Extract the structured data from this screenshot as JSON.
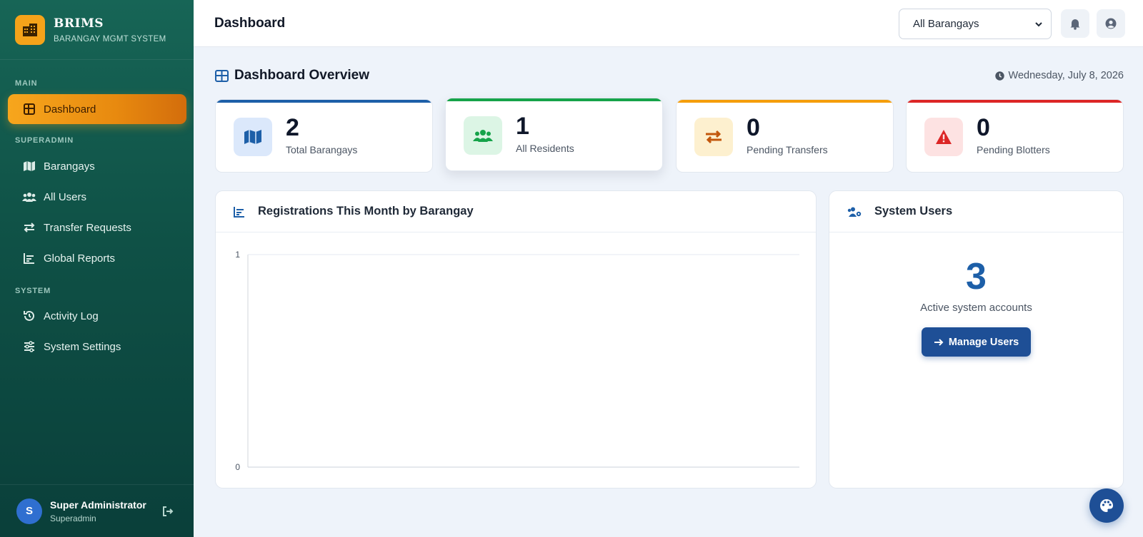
{
  "brand": {
    "title": "BRIMS",
    "subtitle": "BARANGAY MGMT SYSTEM",
    "logo_icon": "building-icon"
  },
  "sidebar": {
    "sections": [
      {
        "label": "MAIN"
      },
      {
        "label": "SUPERADMIN"
      },
      {
        "label": "SYSTEM"
      }
    ],
    "items": [
      {
        "label": "Dashboard",
        "icon": "grid-icon",
        "active": true
      },
      {
        "label": "Barangays",
        "icon": "map-icon"
      },
      {
        "label": "All Users",
        "icon": "users-icon"
      },
      {
        "label": "Transfer Requests",
        "icon": "transfer-icon"
      },
      {
        "label": "Global Reports",
        "icon": "chart-icon"
      },
      {
        "label": "Activity Log",
        "icon": "history-icon"
      },
      {
        "label": "System Settings",
        "icon": "sliders-icon"
      }
    ],
    "user": {
      "initial": "S",
      "name": "Super Administrator",
      "role": "Superadmin"
    }
  },
  "topbar": {
    "title": "Dashboard",
    "barangay_filter": "All Barangays",
    "notification_icon": "bell-icon",
    "profile_icon": "user-circle-icon"
  },
  "overview": {
    "title": "Dashboard Overview",
    "date": "Wednesday, July 8, 2026"
  },
  "stats": [
    {
      "value": "2",
      "label": "Total Barangays",
      "icon": "map-icon",
      "accent": "#1d5fa8",
      "bg": "#dbe8fb"
    },
    {
      "value": "1",
      "label": "All Residents",
      "icon": "users-icon",
      "accent": "#16a34a",
      "bg": "#dcf5e5"
    },
    {
      "value": "0",
      "label": "Pending Transfers",
      "icon": "transfer-icon",
      "accent": "#f59e0b",
      "bg": "#fdf0cf"
    },
    {
      "value": "0",
      "label": "Pending Blotters",
      "icon": "alert-icon",
      "accent": "#dc2626",
      "bg": "#fde2e2"
    }
  ],
  "registrations_card": {
    "title": "Registrations This Month by Barangay"
  },
  "chart_data": {
    "type": "bar",
    "title": "Registrations This Month by Barangay",
    "categories": [],
    "values": [],
    "ylim": [
      0,
      1
    ],
    "yticks": [
      "0",
      "1"
    ],
    "grid": true
  },
  "system_users": {
    "title": "System Users",
    "count": "3",
    "label": "Active system accounts",
    "button_label": "Manage Users"
  },
  "colors": {
    "sidebar": "#0f5146",
    "accent": "#f5a31a",
    "primary": "#1e4f96"
  }
}
